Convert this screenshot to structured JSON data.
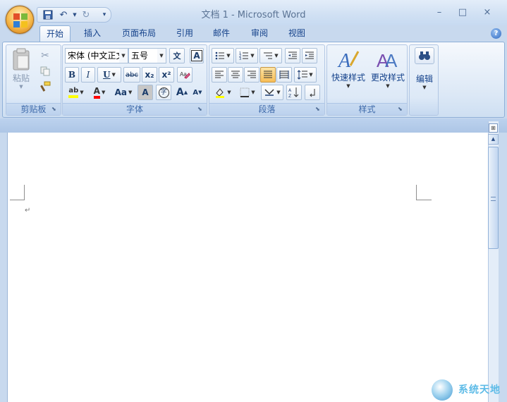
{
  "window": {
    "title": "文档 1 - Microsoft Word",
    "controls": {
      "minimize": "–",
      "maximize": "□",
      "close": "×"
    }
  },
  "qat": {
    "save_icon": "save-icon",
    "undo_icon": "undo-icon",
    "redo_icon": "redo-icon",
    "customize_icon": "customize-qat-icon"
  },
  "tabs": [
    {
      "label": "开始",
      "active": true
    },
    {
      "label": "插入"
    },
    {
      "label": "页面布局"
    },
    {
      "label": "引用"
    },
    {
      "label": "邮件"
    },
    {
      "label": "审阅"
    },
    {
      "label": "视图"
    }
  ],
  "ribbon": {
    "clipboard": {
      "label": "剪贴板",
      "paste": "粘贴",
      "icons": [
        "cut-icon",
        "copy-icon",
        "format-painter-icon"
      ]
    },
    "font": {
      "label": "字体",
      "font_name": "宋体 (中文正文)",
      "font_size": "五号",
      "bold": "B",
      "italic": "I",
      "underline": "U",
      "strikethrough": "abc",
      "subscript": "x₂",
      "superscript": "x²",
      "change_case": "Aa",
      "highlight": "ab",
      "font_color": "A",
      "char_shading": "A",
      "enclose_char": "字",
      "phonetic": "文",
      "char_border": "A",
      "grow": "A",
      "shrink": "A",
      "highlight_color": "#ffff00",
      "font_color_value": "#ff0000"
    },
    "paragraph": {
      "label": "段落"
    },
    "styles": {
      "label": "样式",
      "quick_styles": "快速样式",
      "change_styles": "更改样式"
    },
    "editing": {
      "label": "编辑"
    }
  },
  "document": {
    "paragraph_mark": "↵"
  },
  "watermark": {
    "text": "系统天地"
  },
  "colors": {
    "accent": "#15428b",
    "ribbon_bg": "#dce8f6"
  }
}
